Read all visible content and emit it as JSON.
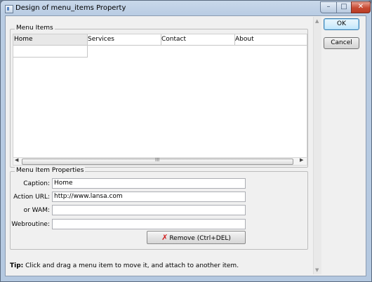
{
  "window": {
    "title": "Design of menu_items Property",
    "controls": {
      "minimize": "–",
      "maximize": "□",
      "close": "✕"
    }
  },
  "buttons": {
    "ok": "OK",
    "cancel": "Cancel"
  },
  "menu_items": {
    "legend": "Menu Items",
    "items": [
      {
        "label": "Home",
        "selected": true
      },
      {
        "label": "Services",
        "selected": false
      },
      {
        "label": "Contact",
        "selected": false
      },
      {
        "label": "About",
        "selected": false
      }
    ],
    "scrollbar_grip": "III"
  },
  "properties": {
    "legend": "Menu Item Properties",
    "caption_label": "Caption:",
    "caption_value": "Home",
    "action_url_label": "Action URL:",
    "action_url_value": "http://www.lansa.com",
    "wam_label": "or WAM:",
    "wam_value": "",
    "webroutine_label": "Webroutine:",
    "webroutine_value": "",
    "remove_label": "Remove (Ctrl+DEL)"
  },
  "tip": {
    "prefix": "Tip:",
    "text": " Click and drag a menu item to move it, and attach to another item."
  },
  "icons": {
    "app": "window-icon",
    "remove": "red-x-icon",
    "scroll_left": "arrow-left-icon",
    "scroll_right": "arrow-right-icon",
    "scroll_up": "arrow-up-icon",
    "scroll_down": "arrow-down-icon"
  }
}
